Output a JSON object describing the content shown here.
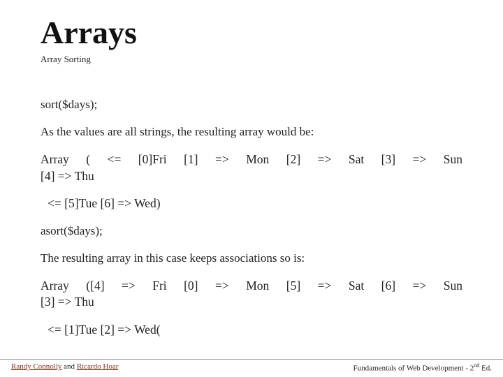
{
  "title": "Arrays",
  "subtitle": "Array Sorting",
  "body": {
    "p1": "sort($days);",
    "p2": " As the values are all strings, the resulting array would be:",
    "p3a": "Array ( <= [0]Fri [1] => Mon [2] => Sat [3] => Sun",
    "p3b": "[4] => Thu",
    "p4": "<= [5]Tue [6] => Wed)",
    "p5": "asort($days);",
    "p6": "The resulting array in this case keeps associations so  is:",
    "p7a": "Array ([4] => Fri [0] => Mon [5] => Sat [6] => Sun",
    "p7b": "[3] => Thu",
    "p8": "<= [1]Tue [2] => Wed("
  },
  "footer": {
    "author1": "Randy Connolly",
    "conj": " and ",
    "author2": "Ricardo Hoar",
    "right_pre": "Fundamentals of Web Development - 2",
    "right_sup": "nd",
    "right_post": " Ed."
  }
}
